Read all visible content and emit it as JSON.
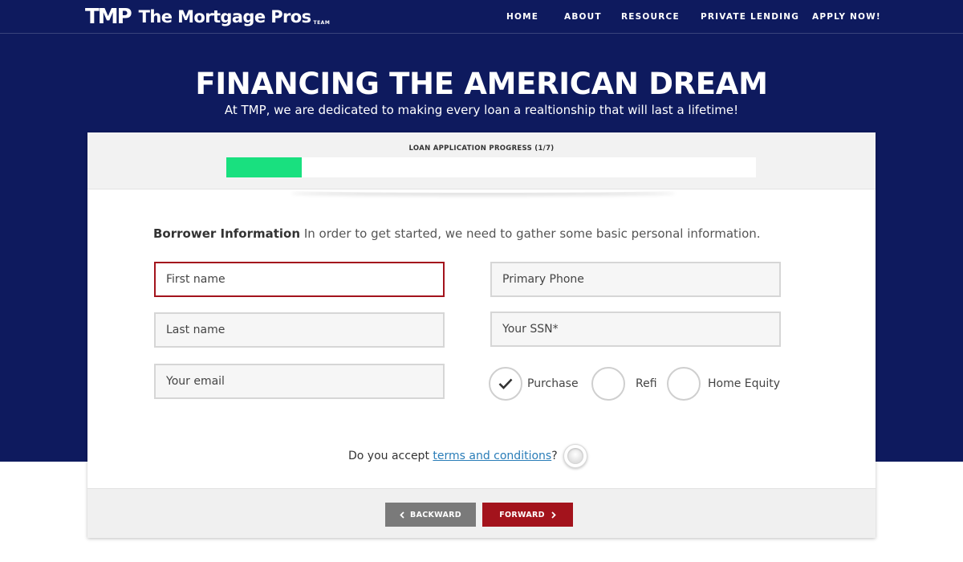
{
  "brand": {
    "mark": "TMP",
    "name": "The Mortgage Pros",
    "suffix": "TEAM",
    "hero_bg": "#0e1a5e"
  },
  "nav": {
    "items": [
      "HOME",
      "ABOUT",
      "RESOURCE",
      "PRIVATE LENDING",
      "APPLY NOW!"
    ]
  },
  "hero": {
    "headline": "FINANCING THE AMERICAN DREAM",
    "subline": "At TMP, we are dedicated to making every loan a realtionship that will last a lifetime!"
  },
  "progress": {
    "label": "LOAN APPLICATION PROGRESS (1/7)",
    "fraction": 0.1429,
    "color": "#19e07f"
  },
  "form": {
    "section_title": "Borrower Information",
    "section_desc": "In order to get started, we need to gather some basic personal information.",
    "first_name_placeholder": "First name",
    "last_name_placeholder": "Last name",
    "email_placeholder": "Your email",
    "phone_placeholder": "Primary Phone",
    "ssn_placeholder": "Your SSN*",
    "loan_types": [
      {
        "label": "Purchase",
        "checked": true
      },
      {
        "label": "Refi",
        "checked": false
      },
      {
        "label": "Home Equity",
        "checked": false
      }
    ],
    "terms_prefix": "Do you accept ",
    "terms_link": "terms and conditions",
    "terms_suffix": "?",
    "error_color": "#a3131c"
  },
  "buttons": {
    "back": "BACKWARD",
    "forward": "FORWARD",
    "back_icon": "chevron-left-icon",
    "forward_icon": "chevron-right-icon"
  }
}
